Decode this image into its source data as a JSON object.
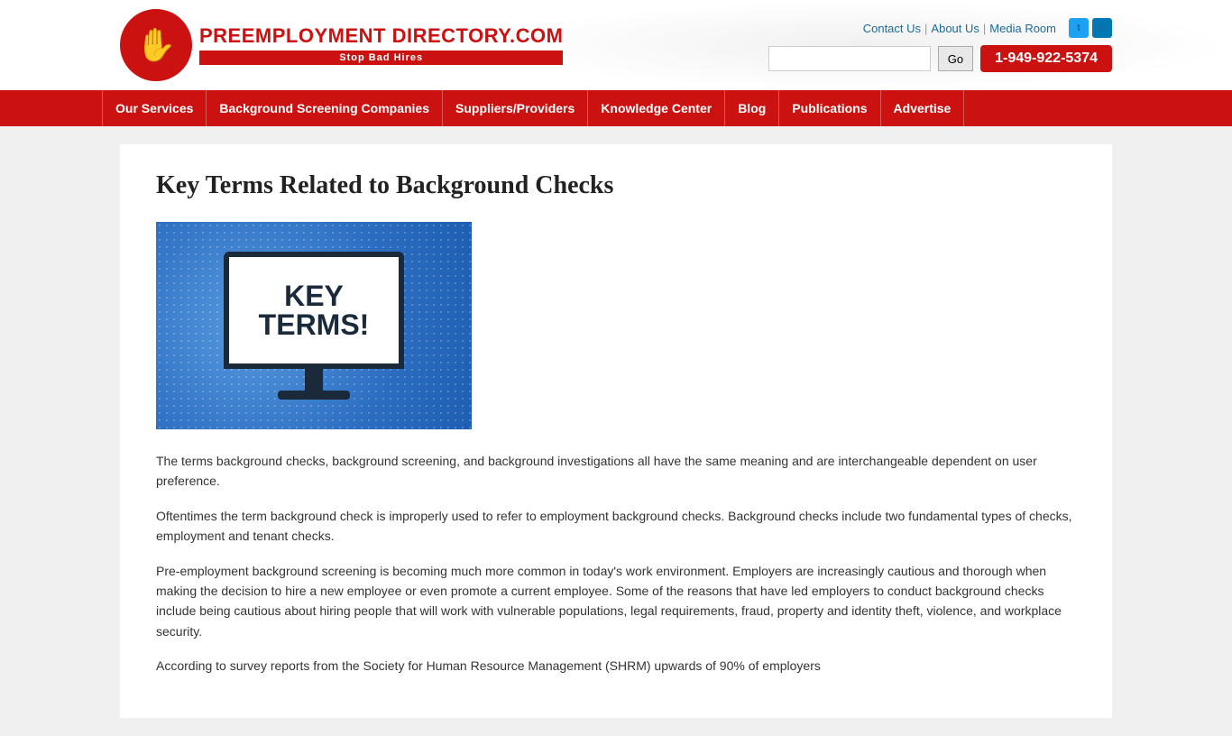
{
  "header": {
    "logo": {
      "text_top": "PREEMPLOYMENT DIRECTORY.COM",
      "text_bottom": "Stop Bad Hires"
    },
    "links": {
      "contact": "Contact Us",
      "about": "About Us",
      "media": "Media Room"
    },
    "social": {
      "twitter_label": "t",
      "linkedin_label": "in"
    },
    "search": {
      "placeholder": "",
      "go_label": "Go"
    },
    "phone": "1-949-922-5374"
  },
  "nav": {
    "items": [
      {
        "label": "Our Services"
      },
      {
        "label": "Background Screening Companies"
      },
      {
        "label": "Suppliers/Providers"
      },
      {
        "label": "Knowledge Center"
      },
      {
        "label": "Blog"
      },
      {
        "label": "Publications"
      },
      {
        "label": "Advertise"
      }
    ]
  },
  "page": {
    "title": "Key Terms Related to Background Checks",
    "image_alt": "Key Terms illustration",
    "monitor_line1": "KEY",
    "monitor_line2": "TERMS!",
    "paragraphs": [
      "The terms background checks, background screening, and background investigations all have the same meaning and are interchangeable dependent on user preference.",
      "Oftentimes the term background check is improperly used to refer to employment background checks. Background checks include two fundamental types of checks, employment and tenant checks.",
      "Pre-employment background screening is becoming much more common in today's work environment.  Employers are increasingly cautious and thorough when making the decision to hire a new employee or even promote a current employee.  Some of the reasons that have led employers to conduct background checks include being cautious about hiring people that will work with vulnerable populations, legal requirements, fraud, property and identity theft, violence, and workplace security.",
      "According to survey reports from the Society for Human Resource Management (SHRM) upwards of 90% of employers"
    ]
  }
}
